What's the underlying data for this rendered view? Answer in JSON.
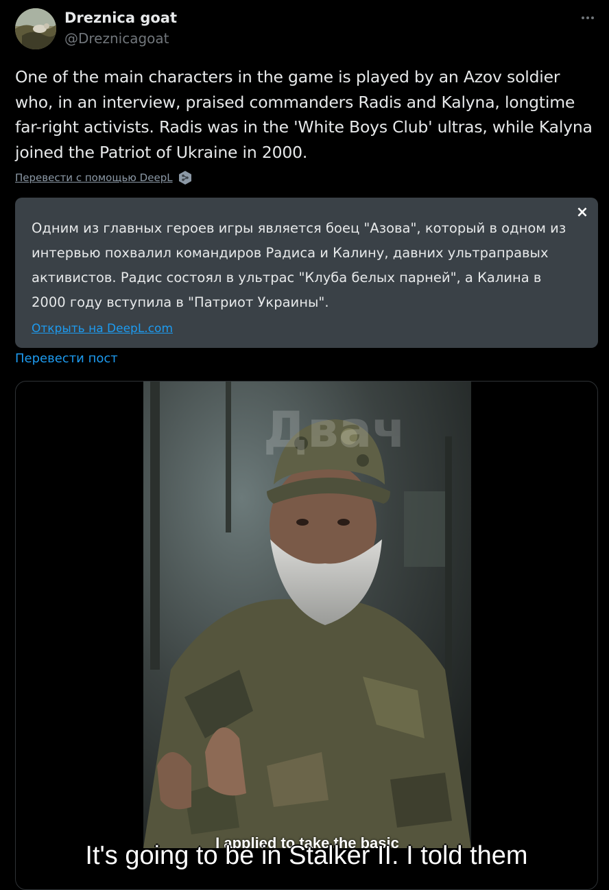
{
  "author": {
    "display_name": "Dreznica goat",
    "handle": "@Dreznicagoat"
  },
  "post": {
    "text": "One of the main characters in the game is played by an Azov soldier who, in an interview, praised commanders Radis and Kalyna, longtime far-right activists. Radis was in the 'White Boys Club' ultras, while Kalyna joined the Patriot of Ukraine in 2000."
  },
  "deepl": {
    "translate_label": "Перевести с помощью DeepL"
  },
  "translation": {
    "text": "Одним из главных героев игры является боец \"Азова\", который в одном из интервью похвалил командиров Радиса и Калину, давних ультраправых активистов. Радис состоял в ультрас \"Клуба белых парней\", а Калина в 2000 году вступила в \"Патриот Украины\".",
    "open_link": "Открыть на DeepL.com",
    "close_symbol": "×"
  },
  "translate_post_label": "Перевести пост",
  "media": {
    "watermark": "Двач",
    "subtitle_inner": "I applied to take the basic",
    "subtitle_outer": "It's going to be in Stalker II. I told them"
  },
  "colors": {
    "background": "#000000",
    "link": "#1d9bf0",
    "muted": "#71767b",
    "translation_bg": "#3a4147"
  }
}
